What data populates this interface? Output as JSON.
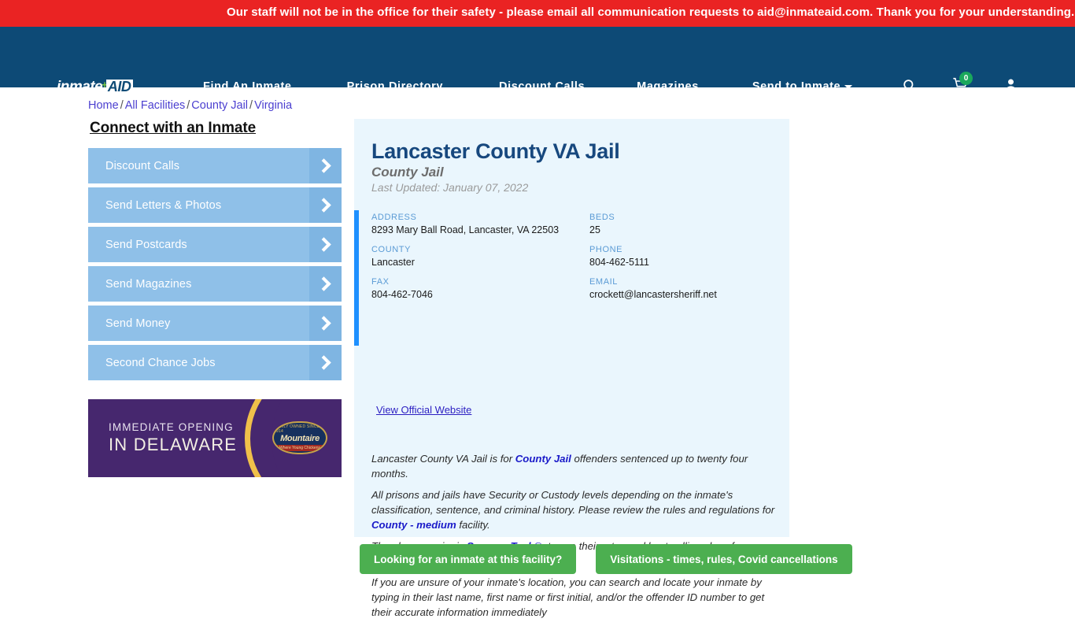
{
  "alert": {
    "message": "Our staff will not be in the office for their safety - please email all communication requests to aid@inmateaid.com. Thank you for your understanding."
  },
  "nav": {
    "logo": {
      "word": "inmate",
      "plus": "+",
      "badge": "AID"
    },
    "links": [
      {
        "label": "Find An Inmate"
      },
      {
        "label": "Prison Directory"
      },
      {
        "label": "Discount Calls"
      },
      {
        "label": "Magazines"
      },
      {
        "label": "Send to Inmate"
      }
    ],
    "icons": {
      "search": "search-icon",
      "cart": "cart-icon",
      "cart_count": "0",
      "account": "user-icon"
    }
  },
  "breadcrumb": {
    "items": [
      "Home",
      "All Facilities",
      "County Jail",
      "Virginia"
    ],
    "separator": "/"
  },
  "sidebar": {
    "heading": "Connect with an Inmate",
    "items": [
      {
        "label": "Discount Calls"
      },
      {
        "label": "Send Letters & Photos"
      },
      {
        "label": "Send Postcards"
      },
      {
        "label": "Send Magazines"
      },
      {
        "label": "Send Money"
      },
      {
        "label": "Second Chance Jobs"
      }
    ]
  },
  "ad": {
    "line1": "IMMEDIATE OPENING",
    "line2": "IN DELAWARE",
    "logo_top": "FAMILY OWNED SINCE 1914",
    "logo_name": "Mountaire",
    "logo_sub": "Where Young Chickens"
  },
  "facility": {
    "title": "Lancaster County VA Jail",
    "subtitle": "County Jail",
    "last_updated": "Last Updated: January 07, 2022",
    "fields": [
      {
        "key": "address",
        "label": "ADDRESS",
        "value": "8293 Mary Ball Road, Lancaster, VA 22503"
      },
      {
        "key": "beds",
        "label": "BEDS",
        "value": "25"
      },
      {
        "key": "county",
        "label": "COUNTY",
        "value": "Lancaster"
      },
      {
        "key": "phone",
        "label": "PHONE",
        "value": "804-462-5111"
      },
      {
        "key": "fax",
        "label": "FAX",
        "value": "804-462-7046"
      },
      {
        "key": "email",
        "label": "EMAIL",
        "value": "crockett@lancastersheriff.net"
      }
    ],
    "official_website_link": "View Official Website",
    "paragraphs": {
      "p1_a": "Lancaster County VA Jail is for ",
      "p1_link": "County Jail",
      "p1_b": " offenders sentenced up to twenty four months.",
      "p2_a": "All prisons and jails have Security or Custody levels depending on the inmate's classification, sentence, and criminal history. Please review the rules and regulations for ",
      "p2_link": "County - medium",
      "p2_b": " facility.",
      "p3_a": "The phone carrier is ",
      "p3_link": "Securus Tech®",
      "p3_b": ", to see their rates and best-calling plans for your inmate to call you.",
      "p4": "If you are unsure of your inmate's location, you can search and locate your inmate by typing in their last name, first name or first initial, and/or the offender ID number to get their accurate information immediately"
    }
  },
  "actions": {
    "find_inmate": "Looking for an inmate at this facility?",
    "visitations": "Visitations - times, rules, Covid cancellations"
  },
  "colors": {
    "alert_red": "#ea2323",
    "nav_blue": "#0d4a76",
    "card_bg": "#eaf6fd",
    "accent_bar": "#1e90ff",
    "sidebar_btn": "#8fc0e8",
    "green_btn": "#4caf50",
    "badge_green": "#1aa85c",
    "title_blue": "#17487e"
  }
}
